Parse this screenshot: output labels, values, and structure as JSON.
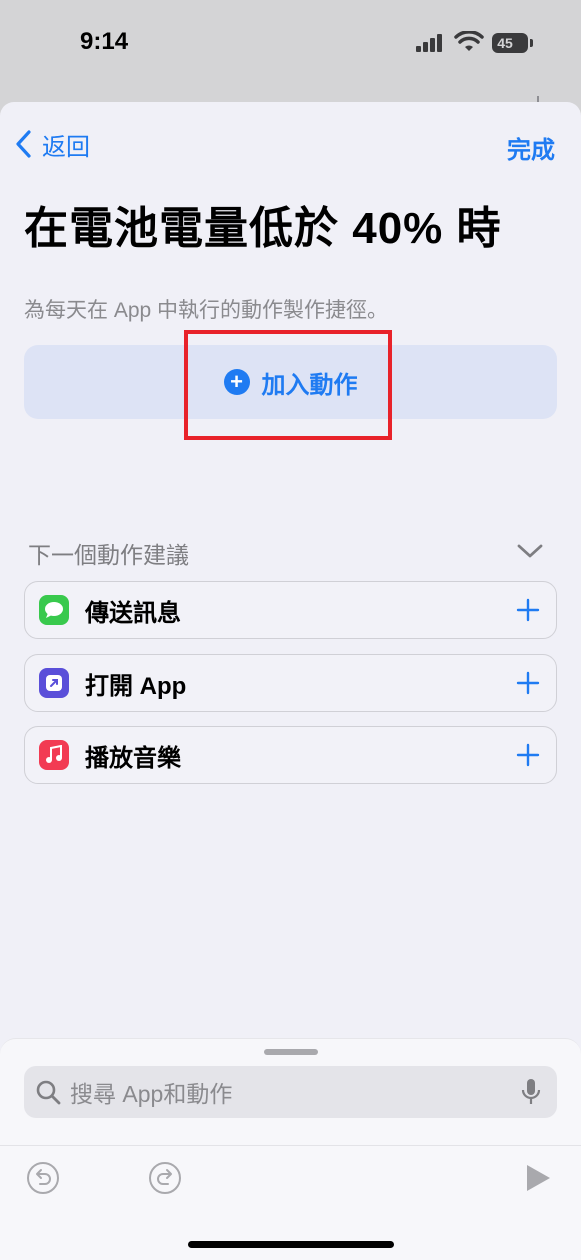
{
  "status_bar": {
    "time": "9:14",
    "battery": "45"
  },
  "nav": {
    "back_label": "返回",
    "done_label": "完成"
  },
  "title": "在電池電量低於 40% 時",
  "subtitle": "為每天在 App 中執行的動作製作捷徑。",
  "add_action": {
    "label": "加入動作"
  },
  "suggestions": {
    "header": "下一個動作建議",
    "items": [
      {
        "label": "傳送訊息",
        "icon": "messages-icon",
        "color": "#39c94d"
      },
      {
        "label": "打開 App",
        "icon": "open-app-icon",
        "color": "#5a4fd9"
      },
      {
        "label": "播放音樂",
        "icon": "music-icon",
        "color": "#f23b53"
      }
    ]
  },
  "search": {
    "placeholder": "搜尋 App和動作"
  },
  "colors": {
    "accent": "#1f7bf2",
    "highlight": "#e8222a"
  }
}
